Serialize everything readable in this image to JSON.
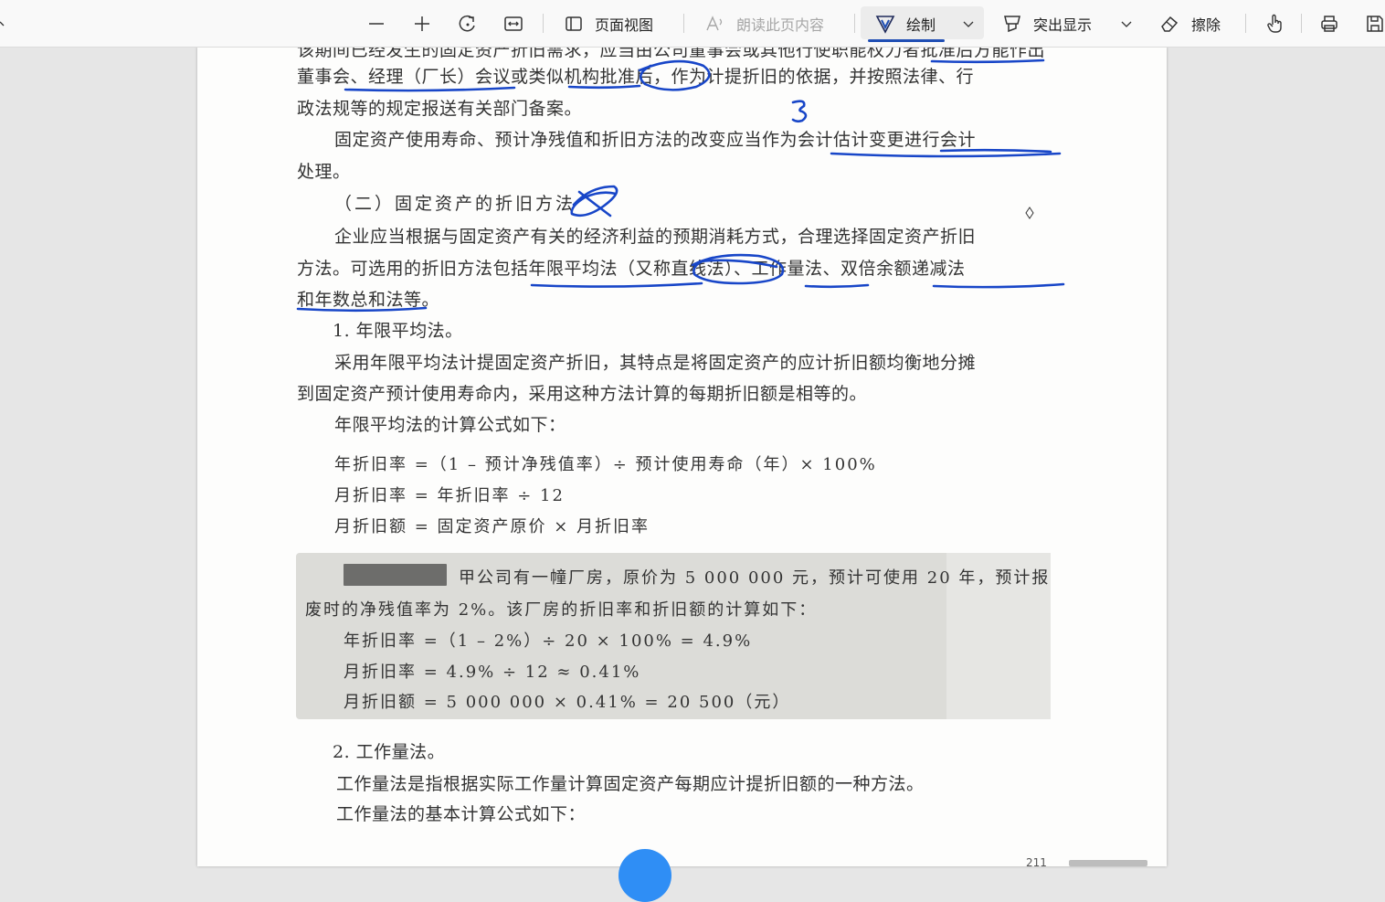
{
  "toolbar": {
    "view_label": "页面视图",
    "read_aloud_label": "朗读此页内容",
    "draw_label": "绘制",
    "highlight_label": "突出显示",
    "erase_label": "擦除"
  },
  "document": {
    "lines": [
      "该期间已经发生的固定资产折旧需求，应当由公司董事会或其他行使职能权力者批准后方能作出",
      "董事会、经理（厂长）会议或类似机构批准后，作为计提折旧的依据，并按照法律、行",
      "政法规等的规定报送有关部门备案。",
      "固定资产使用寿命、预计净残值和折旧方法的改变应当作为会计估计变更进行会计",
      "处理。",
      "（二）固定资产的折旧方法",
      "企业应当根据与固定资产有关的经济利益的预期消耗方式，合理选择固定资产折旧",
      "方法。可选用的折旧方法包括年限平均法（又称直线法）、工作量法、双倍余额递减法",
      "和年数总和法等。",
      "1. 年限平均法。",
      "采用年限平均法计提固定资产折旧，其特点是将固定资产的应计折旧额均衡地分摊",
      "到固定资产预计使用寿命内，采用这种方法计算的每期折旧额是相等的。",
      "年限平均法的计算公式如下："
    ],
    "formulas": [
      "年折旧率 =（1 – 预计净残值率）÷ 预计使用寿命（年）× 100%",
      "月折旧率 = 年折旧率 ÷ 12",
      "月折旧额 = 固定资产原价 × 月折旧率"
    ],
    "example": [
      "甲公司有一幢厂房，原价为 5 000 000 元，预计可使用 20 年，预计报",
      "废时的净残值率为 2%。该厂房的折旧率和折旧额的计算如下：",
      "年折旧率 =（1 – 2%）÷ 20 × 100% = 4.9%",
      "月折旧率 = 4.9% ÷ 12 ≈ 0.41%",
      "月折旧额 = 5 000 000 × 0.41% = 20 500（元）"
    ],
    "lines_after": [
      "2. 工作量法。",
      "工作量法是指根据实际工作量计算固定资产每期应计提折旧额的一种方法。",
      "工作量法的基本计算公式如下："
    ],
    "page_number": "211"
  },
  "colors": {
    "ink": "#1846c8",
    "accent": "#1f4eb4"
  }
}
